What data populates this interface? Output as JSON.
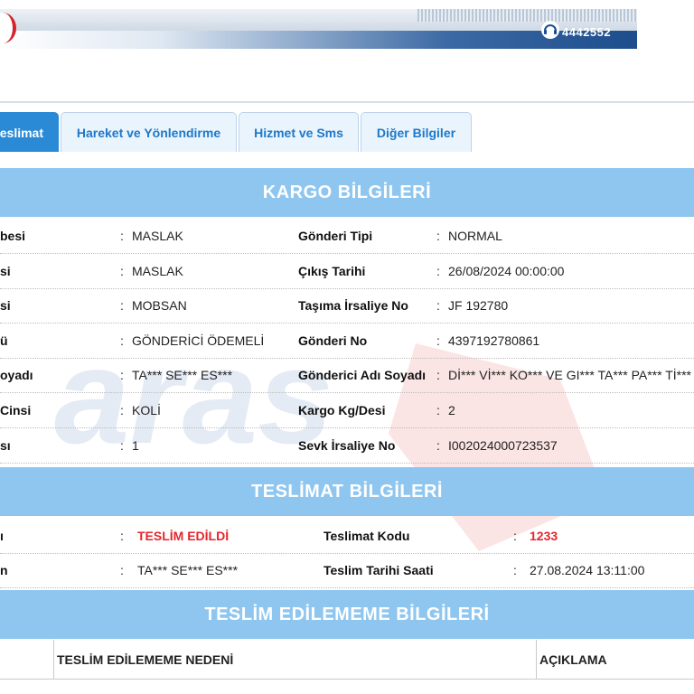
{
  "header": {
    "phone": "4442552"
  },
  "tabs": [
    {
      "label": "Teslimat",
      "visible": "eslimat",
      "active": true
    },
    {
      "label": "Hareket ve Yönlendirme"
    },
    {
      "label": "Hizmet ve Sms"
    },
    {
      "label": "Diğer Bilgiler"
    }
  ],
  "kargo": {
    "title": "KARGO BİLGİLERİ",
    "left": [
      {
        "label": "besi",
        "value": "MASLAK"
      },
      {
        "label": "si",
        "value": "MASLAK"
      },
      {
        "label": "si",
        "value": "MOBSAN"
      },
      {
        "label": "ü",
        "value": "GÖNDERİCİ ÖDEMELİ"
      },
      {
        "label": "oyadı",
        "value": "TA*** SE*** ES***"
      },
      {
        "label": "Cinsi",
        "value": "KOLİ"
      },
      {
        "label": "sı",
        "value": "1"
      }
    ],
    "right": [
      {
        "label": "Gönderi Tipi",
        "value": "NORMAL"
      },
      {
        "label": "Çıkış Tarihi",
        "value": "26/08/2024 00:00:00"
      },
      {
        "label": "Taşıma İrsaliye No",
        "value": "JF 192780"
      },
      {
        "label": "Gönderi No",
        "value": "4397192780861"
      },
      {
        "label": "Gönderici Adı Soyadı",
        "value": "Dİ*** Vİ*** KO*** VE GI*** TA*** PA*** Tİ***"
      },
      {
        "label": "Kargo Kg/Desi",
        "value": "2"
      },
      {
        "label": "Sevk İrsaliye No",
        "value": "I002024000723537"
      }
    ]
  },
  "teslimat": {
    "title": "TESLİMAT BİLGİLERİ",
    "left": [
      {
        "label": "ı",
        "value": "TESLİM EDİLDİ"
      },
      {
        "label": "n",
        "value": "TA*** SE*** ES***"
      }
    ],
    "right": [
      {
        "label": "Teslimat Kodu",
        "value": "1233"
      },
      {
        "label": "Teslim Tarihi Saati",
        "value": "27.08.2024 13:11:00"
      }
    ]
  },
  "edilememe": {
    "title": "TESLİM EDİLEMEME BİLGİLERİ",
    "columns": [
      "TESLİM EDİLEMEME NEDENİ",
      "AÇIKLAMA"
    ]
  },
  "colon": ":",
  "colors": {
    "accent": "#2a8ad6",
    "section": "#8fc6ef",
    "status_red": "#e4262d"
  },
  "watermark_text": "aras"
}
